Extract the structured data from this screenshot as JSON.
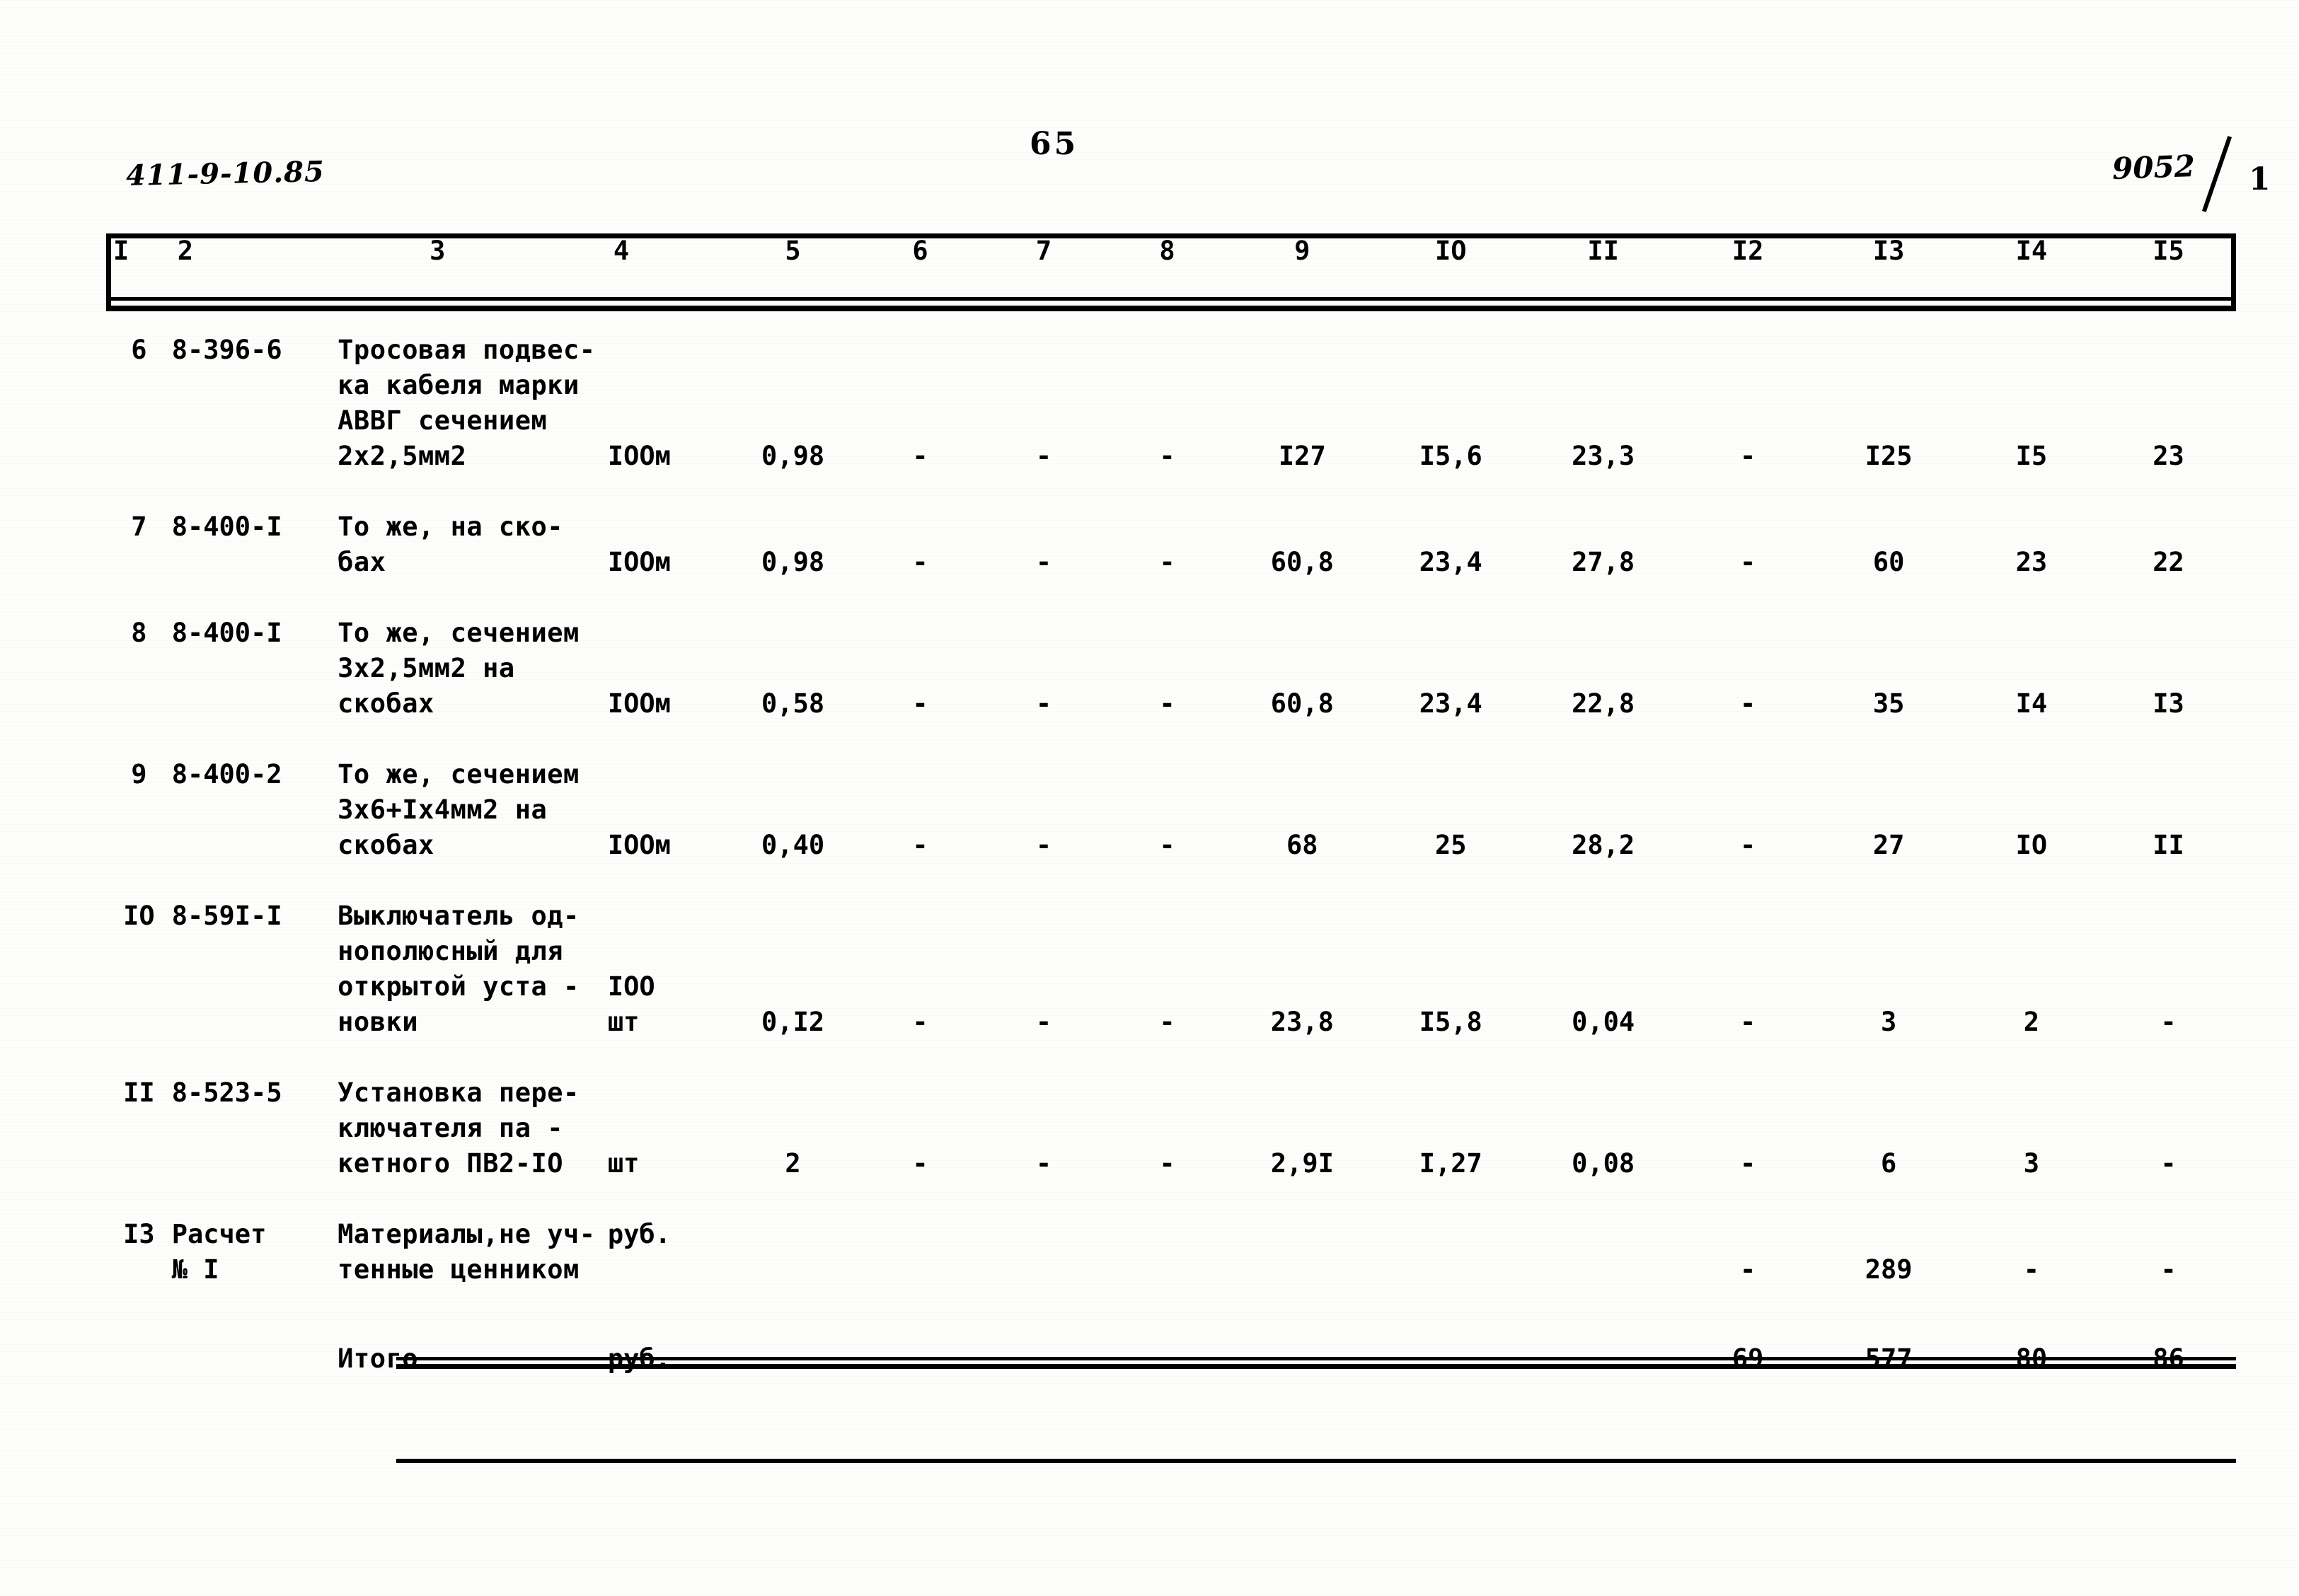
{
  "header": {
    "doc_code": "411-9-10.85",
    "page_number": "65",
    "sheet_code": "9052",
    "sheet_slash_mark": "1"
  },
  "table": {
    "column_headers": [
      "I",
      "2",
      "3",
      "4",
      "5",
      "6",
      "7",
      "8",
      "9",
      "IO",
      "II",
      "I2",
      "I3",
      "I4",
      "I5"
    ],
    "rows": [
      {
        "num": "6",
        "code": "8-396-6",
        "description": "Тросовая подвес-\nка кабеля марки\nАВВГ сечением\n2х2,5мм2",
        "unit": "IOOм",
        "c5": "0,98",
        "c6": "-",
        "c7": "-",
        "c8": "-",
        "c9": "I27",
        "c10": "I5,6",
        "c11": "23,3",
        "c12": "-",
        "c13": "I25",
        "c14": "I5",
        "c15": "23"
      },
      {
        "num": "7",
        "code": "8-400-I",
        "description": "То же, на ско-\nбах",
        "unit": "IOOм",
        "c5": "0,98",
        "c6": "-",
        "c7": "-",
        "c8": "-",
        "c9": "60,8",
        "c10": "23,4",
        "c11": "27,8",
        "c12": "-",
        "c13": "60",
        "c14": "23",
        "c15": "22"
      },
      {
        "num": "8",
        "code": "8-400-I",
        "description": "То же, сечением\n3х2,5мм2 на\nскобах",
        "unit": "IOOм",
        "c5": "0,58",
        "c6": "-",
        "c7": "-",
        "c8": "-",
        "c9": "60,8",
        "c10": "23,4",
        "c11": "22,8",
        "c12": "-",
        "c13": "35",
        "c14": "I4",
        "c15": "I3"
      },
      {
        "num": "9",
        "code": "8-400-2",
        "description": "То же, сечением\n3х6+Iх4мм2 на\nскобах",
        "unit": "IOOм",
        "c5": "0,40",
        "c6": "-",
        "c7": "-",
        "c8": "-",
        "c9": "68",
        "c10": "25",
        "c11": "28,2",
        "c12": "-",
        "c13": "27",
        "c14": "IO",
        "c15": "II"
      },
      {
        "num": "IO",
        "code": "8-59I-I",
        "description": "Выключатель од-\nнополюсный для\nоткрытой уста -\nновки",
        "unit": "IOO\nшт",
        "c5": "0,I2",
        "c6": "-",
        "c7": "-",
        "c8": "-",
        "c9": "23,8",
        "c10": "I5,8",
        "c11": "0,04",
        "c12": "-",
        "c13": "3",
        "c14": "2",
        "c15": "-"
      },
      {
        "num": "II",
        "code": "8-523-5",
        "description": "Установка пере-\nключателя па -\nкетного ПВ2-IO",
        "unit": "шт",
        "c5": "2",
        "c6": "-",
        "c7": "-",
        "c8": "-",
        "c9": "2,9I",
        "c10": "I,27",
        "c11": "0,08",
        "c12": "-",
        "c13": "6",
        "c14": "3",
        "c15": "-"
      },
      {
        "num": "I3",
        "code": "Расчет\n № I",
        "description": "Материалы,не уч-\nтенные ценником",
        "unit": "руб.",
        "c5": "",
        "c6": "",
        "c7": "",
        "c8": "",
        "c9": "",
        "c10": "",
        "c11": "",
        "c12": "-",
        "c13": "289",
        "c14": "-",
        "c15": "-"
      }
    ],
    "total_row": {
      "label": "Итого",
      "unit": "руб.",
      "c5": "",
      "c6": "",
      "c7": "",
      "c8": "",
      "c9": "",
      "c10": "",
      "c11": "",
      "c12": "69",
      "c13": "577",
      "c14": "80",
      "c15": "86"
    }
  }
}
